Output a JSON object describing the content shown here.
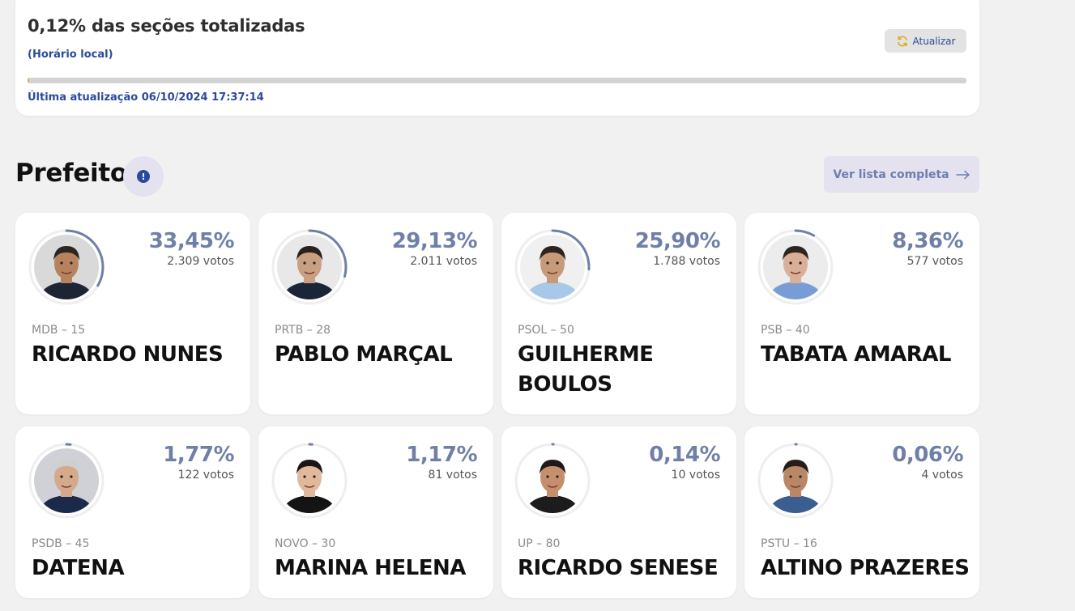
{
  "status": {
    "title": "0,12% das seções totalizadas",
    "subtitle": "(Horário local)",
    "refresh_label": "Atualizar",
    "progress_fraction": 0.0012,
    "updated_text": "Última atualização 06/10/2024 17:37:14",
    "colors": {
      "accent": "#2b4a9c",
      "progress": "#e0a95a",
      "refresh_icon": "#e2a81e"
    }
  },
  "section": {
    "title": "Prefeito",
    "info_icon": "info-icon",
    "list_button_label": "Ver lista completa",
    "list_button_icon": "arrow-right-icon"
  },
  "candidates": [
    {
      "name": "RICARDO NUNES",
      "party": "MDB – 15",
      "percent": "33,45%",
      "votes": "2.309 votos",
      "share": 0.3345
    },
    {
      "name": "PABLO MARÇAL",
      "party": "PRTB – 28",
      "percent": "29,13%",
      "votes": "2.011 votos",
      "share": 0.2913
    },
    {
      "name": "GUILHERME BOULOS",
      "party": "PSOL – 50",
      "percent": "25,90%",
      "votes": "1.788 votos",
      "share": 0.259
    },
    {
      "name": "TABATA AMARAL",
      "party": "PSB – 40",
      "percent": "8,36%",
      "votes": "577 votos",
      "share": 0.0836
    },
    {
      "name": "DATENA",
      "party": "PSDB – 45",
      "percent": "1,77%",
      "votes": "122 votos",
      "share": 0.0177
    },
    {
      "name": "MARINA HELENA",
      "party": "NOVO – 30",
      "percent": "1,17%",
      "votes": "81 votos",
      "share": 0.0117
    },
    {
      "name": "RICARDO SENESE",
      "party": "UP – 80",
      "percent": "0,14%",
      "votes": "10 votos",
      "share": 0.0014
    },
    {
      "name": "ALTINO PRAZERES",
      "party": "PSTU – 16",
      "percent": "0,06%",
      "votes": "4 votos",
      "share": 0.0006
    }
  ],
  "theme": {
    "ring_track": "#eeeeee",
    "ring_fill": "#6f7fa8"
  }
}
